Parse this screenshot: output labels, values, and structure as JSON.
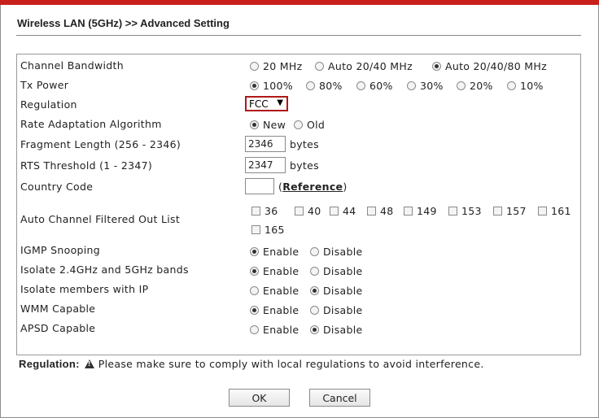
{
  "title": "Wireless LAN (5GHz) >> Advanced Setting",
  "rows": {
    "channel_bandwidth": "Channel Bandwidth",
    "tx_power": "Tx Power",
    "regulation": "Regulation",
    "rate_adaptation": "Rate Adaptation Algorithm",
    "fragment_length": "Fragment Length (256 - 2346)",
    "rts_threshold": "RTS Threshold (1 - 2347)",
    "country_code": "Country Code",
    "auto_channel": "Auto Channel Filtered Out List",
    "igmp": "IGMP Snooping",
    "isolate_bands": "Isolate 2.4GHz and 5GHz bands",
    "isolate_ip": "Isolate members with IP",
    "wmm": "WMM Capable",
    "apsd": "APSD Capable"
  },
  "bandwidth_options": [
    "20 MHz",
    "Auto 20/40 MHz",
    "Auto 20/40/80 MHz"
  ],
  "bandwidth_selected": "Auto 20/40/80 MHz",
  "tx_power_options": [
    "100%",
    "80%",
    "60%",
    "30%",
    "20%",
    "10%"
  ],
  "tx_power_selected": "100%",
  "regulation_value": "FCC",
  "rate_options": [
    "New",
    "Old"
  ],
  "rate_selected": "New",
  "fragment_value": "2346",
  "rts_value": "2347",
  "unit_bytes": "bytes",
  "country_value": "",
  "reference_open": "(",
  "reference_link": "Reference",
  "reference_close": ")",
  "channels": [
    "36",
    "40",
    "44",
    "48",
    "149",
    "153",
    "157",
    "161",
    "165"
  ],
  "enable_label": "Enable",
  "disable_label": "Disable",
  "igmp_selected": "Enable",
  "isolate_bands_selected": "Enable",
  "isolate_ip_selected": "Disable",
  "wmm_selected": "Enable",
  "apsd_selected": "Disable",
  "note_label": "Regulation:",
  "note_text": "Please make sure to comply with local regulations to avoid interference.",
  "ok_label": "OK",
  "cancel_label": "Cancel"
}
